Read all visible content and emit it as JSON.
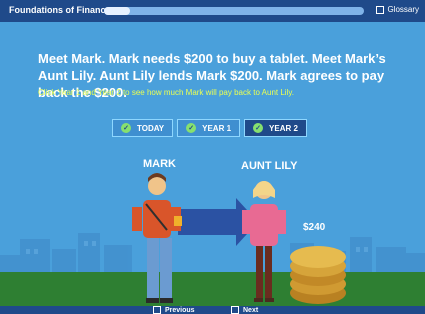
{
  "app": {
    "title": "Foundations of Finance",
    "glossary_label": "Glossary",
    "progress_fraction": 0.1
  },
  "lesson": {
    "paragraph": "Meet Mark. Mark needs $200 to buy a tablet. Meet Mark’s Aunt Lily. Aunt Lily lends Mark $200. Mark agrees to pay back the $200.",
    "instructions": "Click Year 1 and Year 2 to see how much Mark will pay back to Aunt Lily."
  },
  "tabs": [
    {
      "label": "TODAY",
      "checked": true,
      "active": false
    },
    {
      "label": "YEAR 1",
      "checked": true,
      "active": false
    },
    {
      "label": "YEAR 2",
      "checked": true,
      "active": true
    }
  ],
  "scene": {
    "mark_label": "MARK",
    "lily_label": "AUNT LILY",
    "amount": "$240"
  },
  "nav": {
    "previous_label": "Previous",
    "next_label": "Next"
  },
  "colors": {
    "topbar": "#1f4a8a",
    "content": "#4aa0db",
    "instructions": "#eaff52",
    "ground": "#2e7f32",
    "arrow": "#2b52a3"
  },
  "icons": {
    "check": "check-icon",
    "glossary": "glossary-icon",
    "nav_square": "square-icon"
  }
}
